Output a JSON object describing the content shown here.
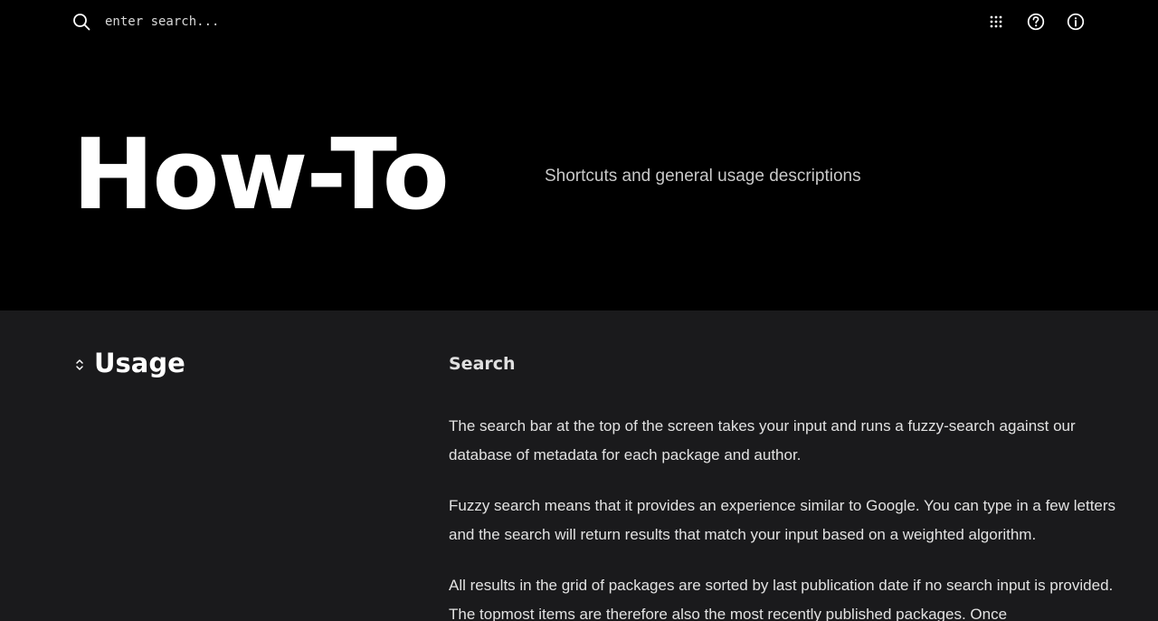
{
  "search": {
    "placeholder": "enter search..."
  },
  "header_icons": [
    {
      "icon": "grid-icon"
    },
    {
      "icon": "help-icon"
    },
    {
      "icon": "info-icon"
    }
  ],
  "hero": {
    "title": "How-To",
    "subtitle": "Shortcuts and general usage descriptions"
  },
  "section": {
    "title": "Usage",
    "subsection_title": "Search",
    "paragraphs": [
      "The search bar at the top of the screen takes your input and runs a fuzzy-search against our database of metadata for each package and author.",
      "Fuzzy search means that it provides an experience similar to Google. You can type in a few letters and the search will return results that match your input based on a weighted algorithm.",
      "All results in the grid of packages are sorted by last publication date if no search input is provided. The topmost items are therefore also the most recently published packages. Once"
    ]
  },
  "colors": {
    "hero_background": "#000000",
    "content_background": "#1a1a1c",
    "text_primary": "#ffffff"
  }
}
